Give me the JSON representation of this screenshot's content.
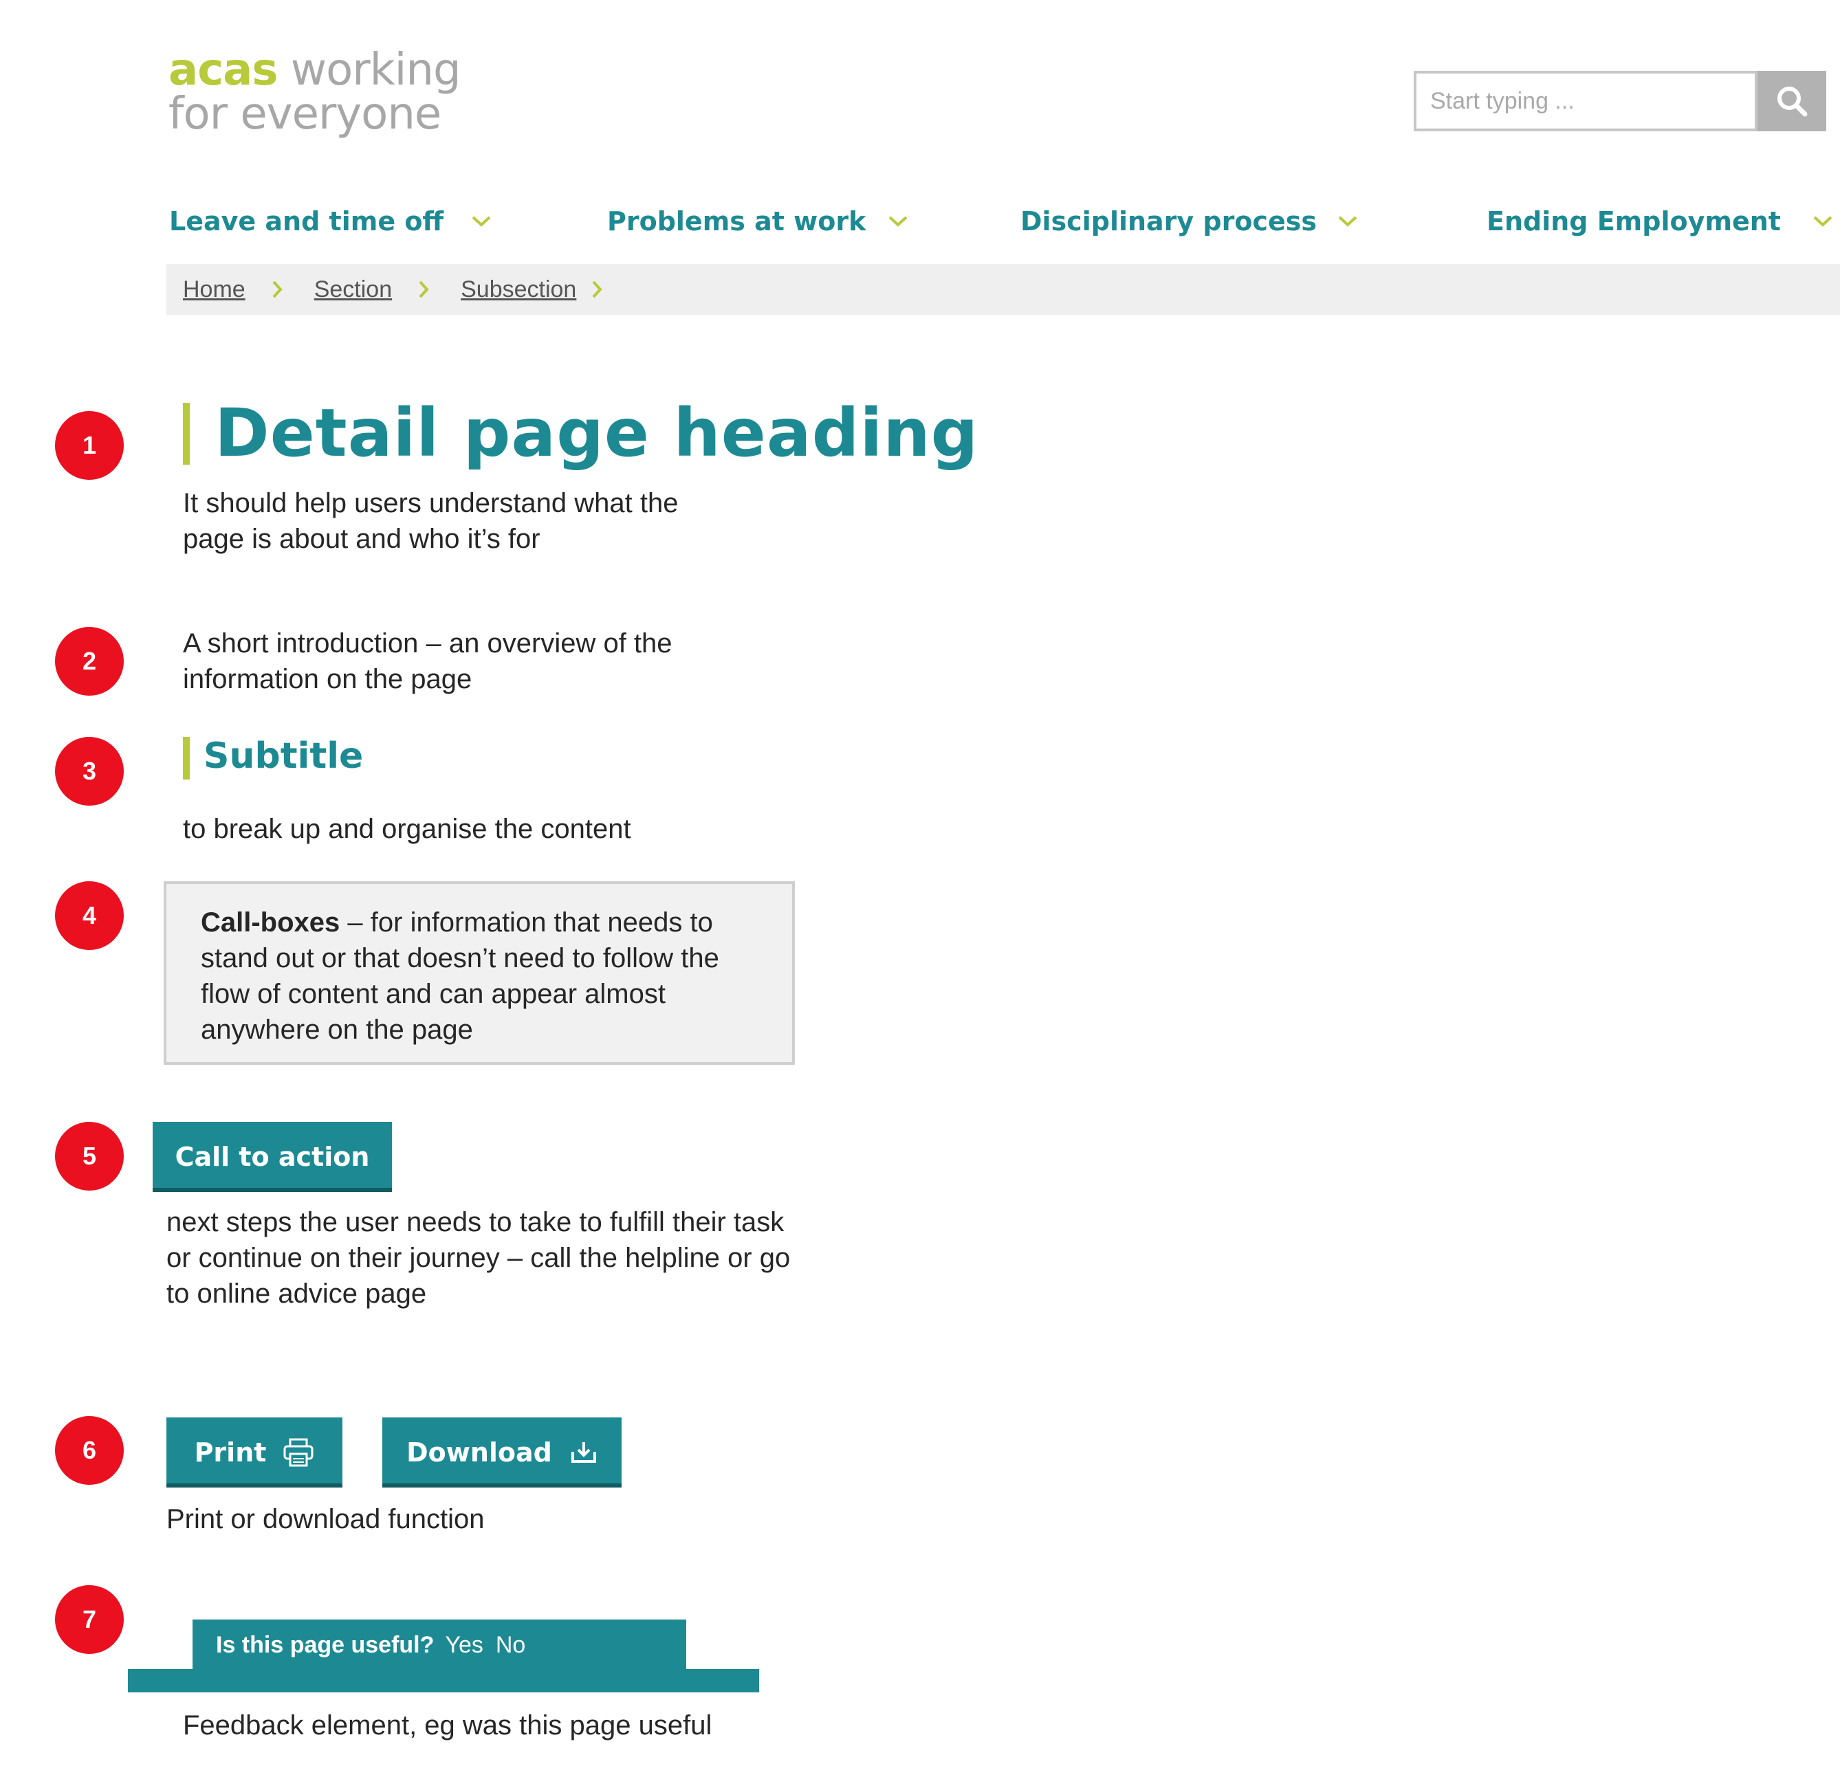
{
  "header": {
    "logo": {
      "brand": "acas",
      "line1_rest": " working",
      "line2": "for everyone"
    },
    "search": {
      "placeholder": "Start typing ..."
    }
  },
  "nav": {
    "items": [
      {
        "label": "Leave and time off"
      },
      {
        "label": "Problems at work"
      },
      {
        "label": "Disciplinary process"
      },
      {
        "label": "Ending Employment"
      }
    ]
  },
  "breadcrumb": [
    "Home",
    "Section",
    "Subsection"
  ],
  "markers": [
    "1",
    "2",
    "3",
    "4",
    "5",
    "6",
    "7"
  ],
  "content": {
    "heading": "Detail page heading",
    "heading_note_1": "It should help users understand what the",
    "heading_note_2": "page is about and who it’s for",
    "intro_1": "A short introduction – an overview of the",
    "intro_2": "information on the page",
    "subtitle": "Subtitle",
    "subtitle_note": "to break up and organise the content",
    "callbox_bold": "Call-boxes",
    "callbox_line_1": " – for information that needs to",
    "callbox_line_2": "stand out or that doesn’t need to follow the",
    "callbox_line_3": "flow of content and can appear almost",
    "callbox_line_4": "anywhere on the page",
    "cta_label": "Call to action",
    "cta_note_1": "next steps the user needs to take to fulfill their task",
    "cta_note_2": "or continue on their journey – call the helpline or go",
    "cta_note_3": "to online advice page",
    "print_label": "Print",
    "download_label": "Download",
    "print_note": "Print or download function",
    "feedback_question": "Is this page useful?",
    "feedback_yes": "Yes",
    "feedback_no": "No",
    "feedback_note": "Feedback element, eg was this page useful"
  },
  "colors": {
    "teal": "#1d8a93",
    "lime": "#b8c93a",
    "marker_red": "#ea1020",
    "breadcrumb_bg": "#efefef"
  }
}
